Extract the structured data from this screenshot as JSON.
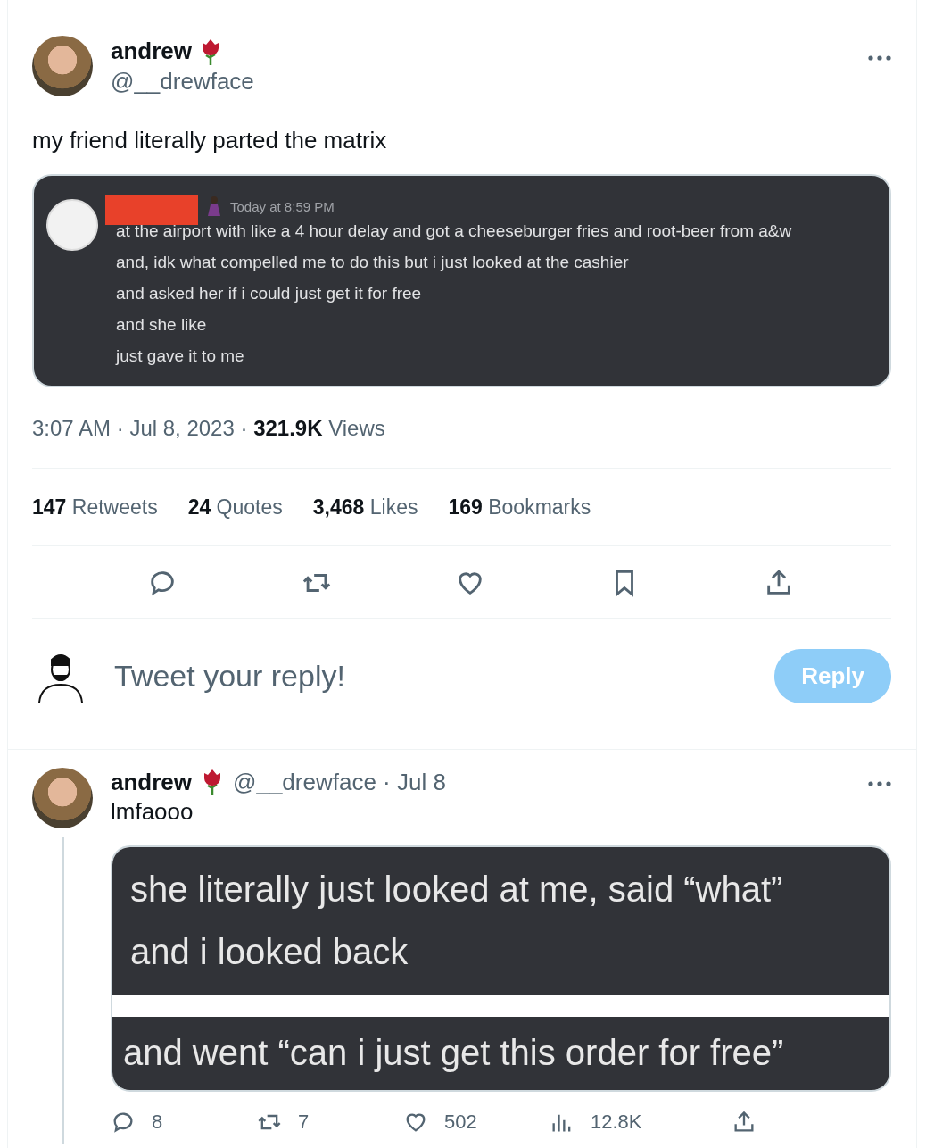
{
  "tweet": {
    "author": {
      "name": "andrew",
      "handle": "@__drewface"
    },
    "text": "my friend literally parted the matrix",
    "embed": {
      "time": "Today at 8:59 PM",
      "lines": [
        "at the airport with like a 4 hour delay and got a cheeseburger fries and root-beer  from a&w",
        "and, idk what compelled me to do this but i just looked at the cashier",
        "and asked her if i could just get it for free",
        "and she like",
        "just gave it to me"
      ]
    },
    "meta": "3:07 AM · Jul 8, 2023 · **321.9K** Views",
    "stats": [
      {
        "count": "147",
        "label": "Retweets"
      },
      {
        "count": "24",
        "label": "Quotes"
      },
      {
        "count": "3,468",
        "label": "Likes"
      },
      {
        "count": "169",
        "label": "Bookmarks"
      }
    ],
    "actions": [
      {
        "kind": "reply"
      },
      {
        "kind": "retweet"
      },
      {
        "kind": "like"
      },
      {
        "kind": "bookmark"
      },
      {
        "kind": "share"
      }
    ]
  },
  "composer": {
    "placeholder": "Tweet your reply!",
    "button": "Reply",
    "disabled": true
  },
  "reply": {
    "author": {
      "name": "andrew",
      "handle": "@__drewface · Jul 8"
    },
    "text": "lmfaooo",
    "image_blocks": [
      {
        "lines": [
          "she literally just looked at me, said “what”",
          "and i looked back"
        ]
      },
      {
        "lines": [
          "and went “can i just get this order for free”"
        ]
      }
    ],
    "actions": [
      {
        "kind": "reply",
        "count": "8"
      },
      {
        "kind": "retweet",
        "count": "7"
      },
      {
        "kind": "like",
        "count": "502"
      },
      {
        "kind": "views",
        "count": "12.8K"
      },
      {
        "kind": "share"
      }
    ]
  }
}
